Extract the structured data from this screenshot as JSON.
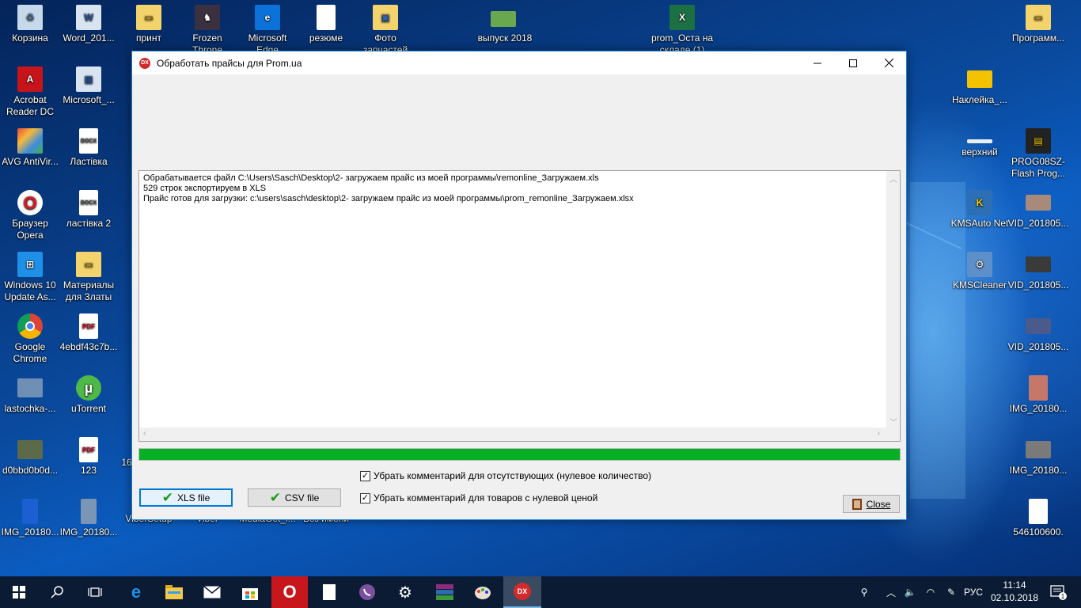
{
  "desktop": {
    "left_icons": [
      {
        "label": "Корзина",
        "icon": "recycle-bin-icon"
      },
      {
        "label": "Word_201...",
        "icon": "word-shortcut-icon"
      },
      {
        "label": "принт",
        "icon": "folder-icon"
      },
      {
        "label": "Frozen Throne",
        "icon": "game-icon"
      },
      {
        "label": "Microsoft Edge",
        "icon": "edge-icon"
      },
      {
        "label": "резюме",
        "icon": "document-icon"
      },
      {
        "label": "Фото запчастей",
        "icon": "folder-icon"
      },
      {
        "label": "выпуск 2018",
        "icon": "image-icon"
      },
      {
        "label": "prom_Оста на складе (1)",
        "icon": "excel-icon"
      },
      {
        "label": "Acrobat Reader DC",
        "icon": "acrobat-icon"
      },
      {
        "label": "Microsoft_...",
        "icon": "installer-icon"
      },
      {
        "label": "AVG AntiVir...",
        "icon": "avg-icon"
      },
      {
        "label": "Ластівка",
        "icon": "docx-icon"
      },
      {
        "label": "Браузер Opera",
        "icon": "opera-icon"
      },
      {
        "label": "ластівка 2",
        "icon": "docx-icon"
      },
      {
        "label": "Windows 10 Update As...",
        "icon": "windows-icon"
      },
      {
        "label": "Материалы для Златы",
        "icon": "folder-icon"
      },
      {
        "label": "Google Chrome",
        "icon": "chrome-icon"
      },
      {
        "label": "4ebdf43c7b...",
        "icon": "pdf-icon"
      },
      {
        "label": "lastochka-...",
        "icon": "image-icon"
      },
      {
        "label": "uTorrent",
        "icon": "utorrent-icon"
      },
      {
        "label": "d0bbd0b0d...",
        "icon": "image-icon"
      },
      {
        "label": "123",
        "icon": "pdf-icon"
      },
      {
        "label": "IMG_20180...",
        "icon": "image-icon"
      },
      {
        "label": "IMG_20180...",
        "icon": "image-icon"
      },
      {
        "label": "ViberSetup",
        "icon": "installer-icon"
      },
      {
        "label": "Viber",
        "icon": "viber-icon"
      },
      {
        "label": "MediaGet_i...",
        "icon": "installer-icon"
      },
      {
        "label": "Без имени",
        "icon": "document-icon"
      }
    ],
    "right_icons": [
      {
        "label": "Программ...",
        "icon": "folder-icon"
      },
      {
        "label": "Наклейка_...",
        "icon": "image-icon"
      },
      {
        "label": "верхний",
        "icon": "image-icon"
      },
      {
        "label": "PROG08SZ-Flash Prog...",
        "icon": "chip-icon"
      },
      {
        "label": "KMSAuto Net",
        "icon": "kms-icon"
      },
      {
        "label": "VID_201805...",
        "icon": "video-icon"
      },
      {
        "label": "KMSCleaner",
        "icon": "kms-icon"
      },
      {
        "label": "VID_201805...",
        "icon": "video-icon"
      },
      {
        "label": "VID_201805...",
        "icon": "video-icon"
      },
      {
        "label": "IMG_20180...",
        "icon": "image-icon"
      },
      {
        "label": "IMG_20180...",
        "icon": "image-icon"
      },
      {
        "label": "546100600.",
        "icon": "document-icon"
      }
    ],
    "partial_label_16": "16"
  },
  "window": {
    "title": "Обработать прайсы для Prom.ua",
    "app_icon_text": "DX",
    "log_lines": [
      "Обрабатывается файл C:\\Users\\Sasch\\Desktop\\2- загружаем прайс из моей программы\\remonline_Загружаем.xls",
      "529 строк экспортируем в XLS",
      "Прайс готов для загрузки: c:\\users\\sasch\\desktop\\2- загружаем прайс из моей программы\\prom_remonline_Загружаем.xlsx"
    ],
    "progress_fraction": 1.0,
    "checkbox1_label": "Убрать комментарий для отсутствующих (нулевое количество)",
    "checkbox1_checked": true,
    "checkbox2_label": "Убрать комментарий для товаров с нулевой ценой",
    "checkbox2_checked": true,
    "xls_button_label": "XLS file",
    "csv_button_label": "CSV file",
    "close_button_label": "Close"
  },
  "taskbar": {
    "language": "РУС",
    "time": "11:14",
    "date": "02.10.2018",
    "notification_count": "1",
    "opera_icon_text": "O",
    "dx_icon_text": "DX"
  },
  "colors": {
    "progress": "#06b025",
    "accent": "#0078d7",
    "taskbar": "#0b1b33"
  }
}
